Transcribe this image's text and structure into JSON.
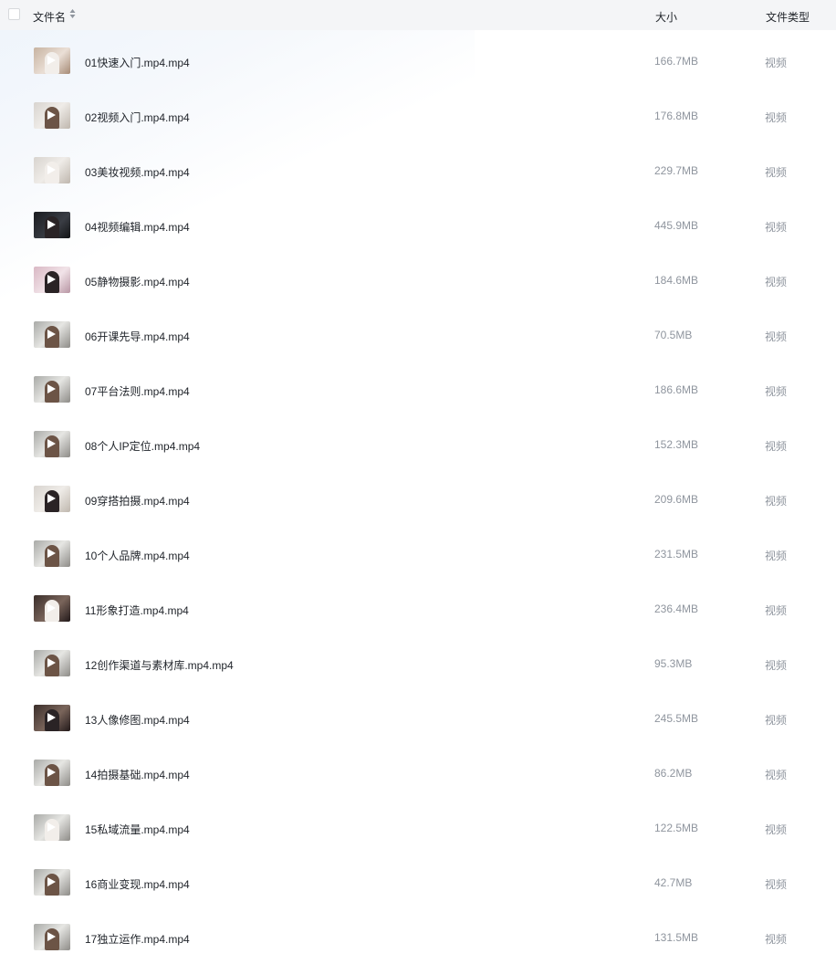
{
  "header": {
    "name_label": "文件名",
    "size_label": "大小",
    "type_label": "文件类型"
  },
  "files": [
    {
      "name": "01快速入门.mp4.mp4",
      "size": "166.7MB",
      "type": "视频",
      "thumb": "t-warm",
      "fig": "fig-light"
    },
    {
      "name": "02视频入门.mp4.mp4",
      "size": "176.8MB",
      "type": "视频",
      "thumb": "t-light",
      "fig": "fig-brown"
    },
    {
      "name": "03美妆视频.mp4.mp4",
      "size": "229.7MB",
      "type": "视频",
      "thumb": "t-light",
      "fig": "fig-light"
    },
    {
      "name": "04视频编辑.mp4.mp4",
      "size": "445.9MB",
      "type": "视频",
      "thumb": "t-dark",
      "fig": "fig-dark"
    },
    {
      "name": "05静物摄影.mp4.mp4",
      "size": "184.6MB",
      "type": "视频",
      "thumb": "t-pink",
      "fig": "fig-dark"
    },
    {
      "name": "06开课先导.mp4.mp4",
      "size": "70.5MB",
      "type": "视频",
      "thumb": "t-grey",
      "fig": "fig-brown"
    },
    {
      "name": "07平台法则.mp4.mp4",
      "size": "186.6MB",
      "type": "视频",
      "thumb": "t-grey",
      "fig": "fig-brown"
    },
    {
      "name": "08个人IP定位.mp4.mp4",
      "size": "152.3MB",
      "type": "视频",
      "thumb": "t-grey",
      "fig": "fig-brown"
    },
    {
      "name": "09穿搭拍摄.mp4.mp4",
      "size": "209.6MB",
      "type": "视频",
      "thumb": "t-light",
      "fig": "fig-dark"
    },
    {
      "name": "10个人品牌.mp4.mp4",
      "size": "231.5MB",
      "type": "视频",
      "thumb": "t-grey",
      "fig": "fig-brown"
    },
    {
      "name": "11形象打造.mp4.mp4",
      "size": "236.4MB",
      "type": "视频",
      "thumb": "t-deep",
      "fig": "fig-light"
    },
    {
      "name": "12创作渠道与素材库.mp4.mp4",
      "size": "95.3MB",
      "type": "视频",
      "thumb": "t-grey",
      "fig": "fig-brown"
    },
    {
      "name": "13人像修图.mp4.mp4",
      "size": "245.5MB",
      "type": "视频",
      "thumb": "t-deep",
      "fig": "fig-dark"
    },
    {
      "name": "14拍摄基础.mp4.mp4",
      "size": "86.2MB",
      "type": "视频",
      "thumb": "t-grey",
      "fig": "fig-brown"
    },
    {
      "name": "15私域流量.mp4.mp4",
      "size": "122.5MB",
      "type": "视频",
      "thumb": "t-grey",
      "fig": "fig-light"
    },
    {
      "name": "16商业变现.mp4.mp4",
      "size": "42.7MB",
      "type": "视频",
      "thumb": "t-grey",
      "fig": "fig-brown"
    },
    {
      "name": "17独立运作.mp4.mp4",
      "size": "131.5MB",
      "type": "视频",
      "thumb": "t-grey",
      "fig": "fig-brown"
    }
  ]
}
